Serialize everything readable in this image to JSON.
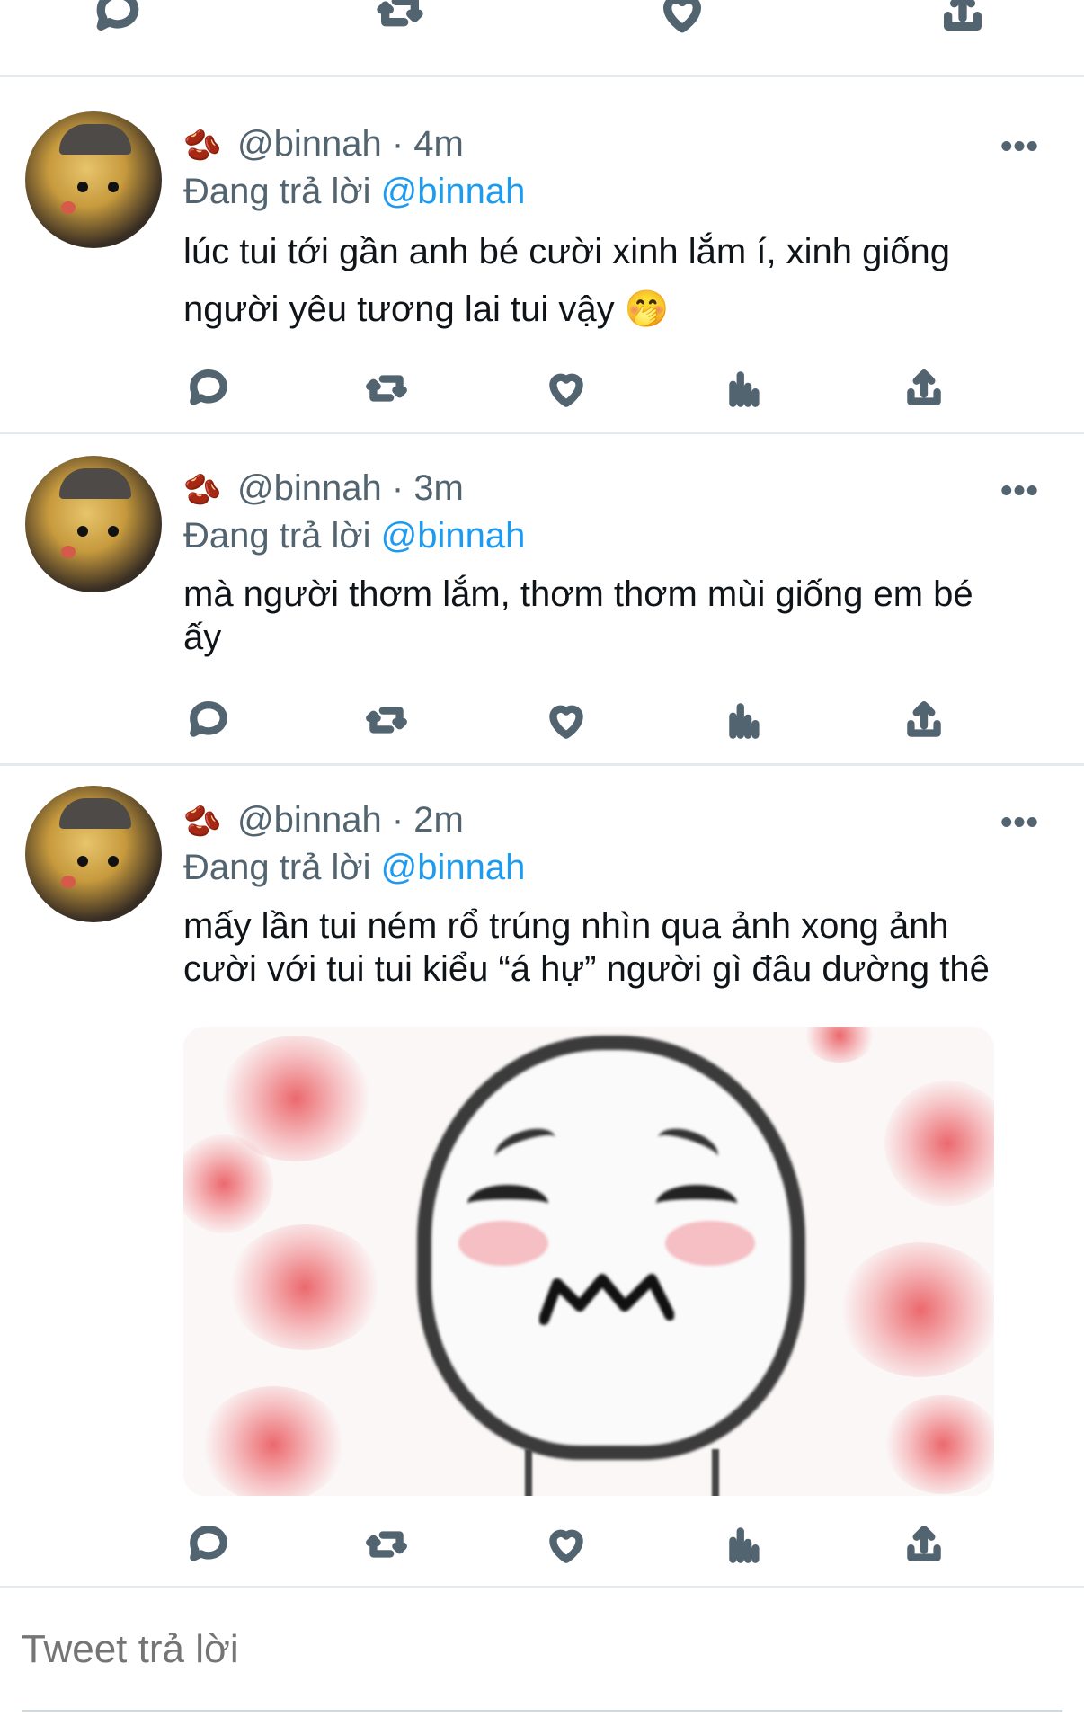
{
  "tweets": [
    {
      "badge": "🫘",
      "handle": "@binnah",
      "time": "4m",
      "replying_prefix": "Đang trả lời ",
      "replying_to": "@binnah",
      "text_line1": "lúc tui tới gần anh bé cười xinh lắm í, xinh giống",
      "text_line2": "người yêu tương lai tui vậy 🤭",
      "more": "•••"
    },
    {
      "badge": "🫘",
      "handle": "@binnah",
      "time": "3m",
      "replying_prefix": "Đang trả lời ",
      "replying_to": "@binnah",
      "text_line1": "mà người thơm lắm, thơm thơm mùi giống em bé",
      "text_line2": "ấy",
      "more": "•••"
    },
    {
      "badge": "🫘",
      "handle": "@binnah",
      "time": "2m",
      "replying_prefix": "Đang trả lời ",
      "replying_to": "@binnah",
      "text_line1": "mấy lần tui ném rổ trúng nhìn qua ảnh xong ảnh",
      "text_line2": "cười với tui tui kiểu “á hự” người gì đâu dường thê",
      "more": "•••"
    }
  ],
  "reply": {
    "placeholder": "Tweet trả lời"
  },
  "icons": {
    "reply": "comment-icon",
    "retweet": "retweet-icon",
    "like": "heart-icon",
    "analytics": "analytics-icon",
    "share": "share-icon"
  },
  "colors": {
    "link": "#1d9bf0",
    "muted": "#536471",
    "divider": "#e6e9ec"
  }
}
